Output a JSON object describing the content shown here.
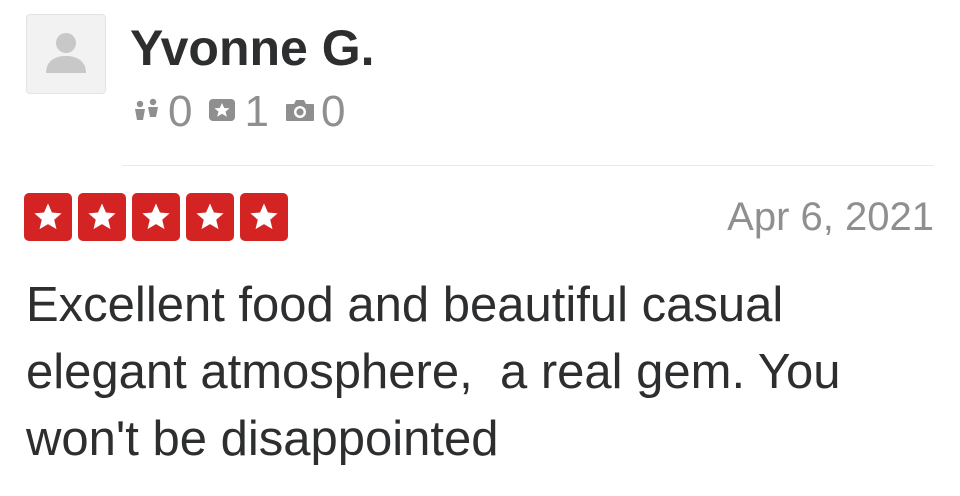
{
  "user": {
    "name": "Yvonne G.",
    "avatar_icon": "default-user-silhouette-icon",
    "stats": [
      {
        "icon": "friends-icon",
        "value": "0"
      },
      {
        "icon": "reviews-icon",
        "value": "1"
      },
      {
        "icon": "photos-icon",
        "value": "0"
      }
    ]
  },
  "review": {
    "rating": 5,
    "max_rating": 5,
    "date": "Apr 6, 2021",
    "text": "Excellent food and beautiful casual elegant atmosphere,  a real gem. You won't be disappointed"
  },
  "colors": {
    "star_background": "#d32323",
    "text": "#2d2e2f",
    "muted": "#8f8f8f"
  }
}
